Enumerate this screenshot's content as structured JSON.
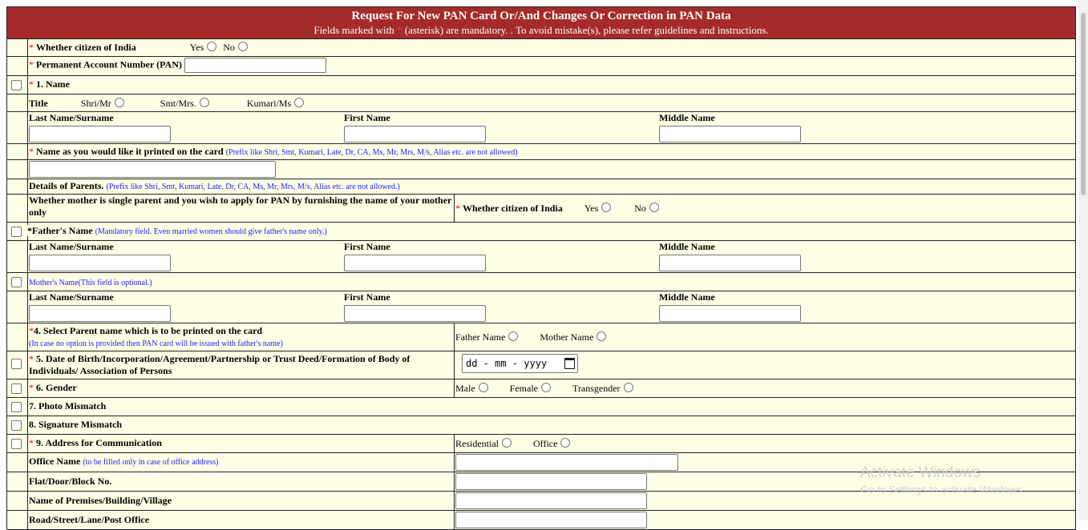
{
  "header": {
    "title": "Request For New PAN Card Or/And Changes Or Correction in PAN Data",
    "subtitle_pre": "Fields marked with",
    "subtitle_asterisk": "*",
    "subtitle_post": "(asterisk) are mandatory. . To avoid mistake(s), please refer guidelines and instructions."
  },
  "citizen": {
    "label": "Whether citizen of India",
    "yes": "Yes",
    "no": "No"
  },
  "pan": {
    "label": "Permanent Account Number (PAN)",
    "value": ""
  },
  "name_section": {
    "label": "1. Name",
    "title_label": "Title",
    "titles": [
      "Shri/Mr",
      "Smt/Mrs.",
      "Kumari/Ms"
    ],
    "last_label": "Last Name/Surname",
    "first_label": "First Name",
    "middle_label": "Middle Name"
  },
  "print_name": {
    "label": "Name as you would like it printed on the card",
    "note": "(Prefix like Shri, Smt, Kumari, Late, Dr, CA, Ms, Mr, Mrs, M/s, Alias etc. are not allowed)"
  },
  "parents": {
    "label": "Details of Parents.",
    "note": "(Prefix like Shri, Smt, Kumari, Late, Dr, CA, Ms, Mr, Mrs, M/s, Alias etc. are not allowed.)"
  },
  "single_parent": {
    "label": "Whether mother is single parent and you wish to apply for PAN by furnishing the name of your mother only",
    "citizen_label": "Whether citizen of India",
    "yes": "Yes",
    "no": "No"
  },
  "father": {
    "label": "*Father's Name",
    "note": "(Mandatory field. Even married women should give father's name only.)",
    "last_label": "Last Name/Surname",
    "first_label": "First Name",
    "middle_label": "Middle Name"
  },
  "mother": {
    "label": "Mother's Name(This field is optional.)",
    "last_label": "Last Name/Surname",
    "first_label": "First Name",
    "middle_label": "Middle Name"
  },
  "parent_print": {
    "label": "4. Select Parent name which is to be printed on the card",
    "note": "(In case no option is provided then PAN card will be issued with father's name)",
    "father": "Father Name",
    "mother": "Mother Name"
  },
  "dob": {
    "label": "5. Date of Birth/Incorporation/Agreement/Partnership or Trust Deed/Formation of Body of Individuals/ Association of Persons",
    "placeholder": "dd - mm - yyyy"
  },
  "gender": {
    "label": "6. Gender",
    "options": [
      "Male",
      "Female",
      "Transgender"
    ]
  },
  "photo_mismatch": {
    "label": "7. Photo Mismatch"
  },
  "signature_mismatch": {
    "label": "8. Signature Mismatch"
  },
  "address": {
    "label": "9. Address for Communication",
    "options": [
      "Residential",
      "Office"
    ]
  },
  "office_name": {
    "label": "Office Name",
    "note": "(to be filled only in case of office address)"
  },
  "flat": {
    "label": "Flat/Door/Block No."
  },
  "premises": {
    "label": "Name of Premises/Building/Village"
  },
  "road": {
    "label": "Road/Street/Lane/Post Office"
  },
  "watermark": {
    "line1": "Activate Windows",
    "line2": "Go to Settings to activate Windows."
  },
  "colors": {
    "header_bg": "#a52a2a",
    "form_bg": "#ffffe6",
    "note": "#1a1aff",
    "asterisk": "#e00000"
  }
}
